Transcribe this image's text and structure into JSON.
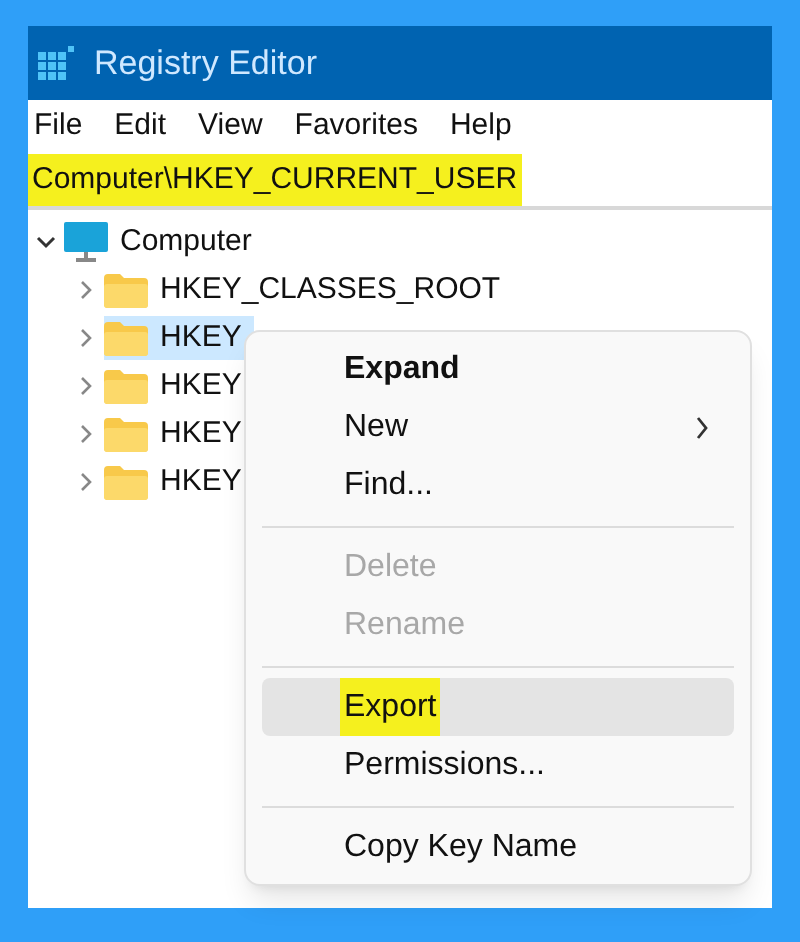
{
  "window": {
    "title": "Registry Editor"
  },
  "menu_bar": [
    "File",
    "Edit",
    "View",
    "Favorites",
    "Help"
  ],
  "address_bar": {
    "value": "Computer\\HKEY_CURRENT_USER",
    "highlighted": true
  },
  "tree": [
    {
      "label": "Computer",
      "expanded": true,
      "selected": false,
      "children": [
        {
          "label": "HKEY_CLASSES_ROOT",
          "expanded": false,
          "selected": false
        },
        {
          "label": "HKEY",
          "expanded": false,
          "selected": true
        },
        {
          "label": "HKEY",
          "expanded": false,
          "selected": false
        },
        {
          "label": "HKEY",
          "expanded": false,
          "selected": false
        },
        {
          "label": "HKEY",
          "expanded": false,
          "selected": false
        }
      ]
    }
  ],
  "context_menu": [
    {
      "kind": "item",
      "label": "Expand",
      "default": true,
      "disabled": false,
      "submenu": false,
      "hovered": false,
      "highlighted": false
    },
    {
      "kind": "item",
      "label": "New",
      "default": false,
      "disabled": false,
      "submenu": true,
      "hovered": false,
      "highlighted": false
    },
    {
      "kind": "item",
      "label": "Find...",
      "default": false,
      "disabled": false,
      "submenu": false,
      "hovered": false,
      "highlighted": false
    },
    {
      "kind": "separator"
    },
    {
      "kind": "item",
      "label": "Delete",
      "default": false,
      "disabled": true,
      "submenu": false,
      "hovered": false,
      "highlighted": false
    },
    {
      "kind": "item",
      "label": "Rename",
      "default": false,
      "disabled": true,
      "submenu": false,
      "hovered": false,
      "highlighted": false
    },
    {
      "kind": "separator"
    },
    {
      "kind": "item",
      "label": "Export",
      "default": false,
      "disabled": false,
      "submenu": false,
      "hovered": true,
      "highlighted": true
    },
    {
      "kind": "item",
      "label": "Permissions...",
      "default": false,
      "disabled": false,
      "submenu": false,
      "hovered": false,
      "highlighted": false
    },
    {
      "kind": "separator"
    },
    {
      "kind": "item",
      "label": "Copy Key Name",
      "default": false,
      "disabled": false,
      "submenu": false,
      "hovered": false,
      "highlighted": false
    }
  ]
}
